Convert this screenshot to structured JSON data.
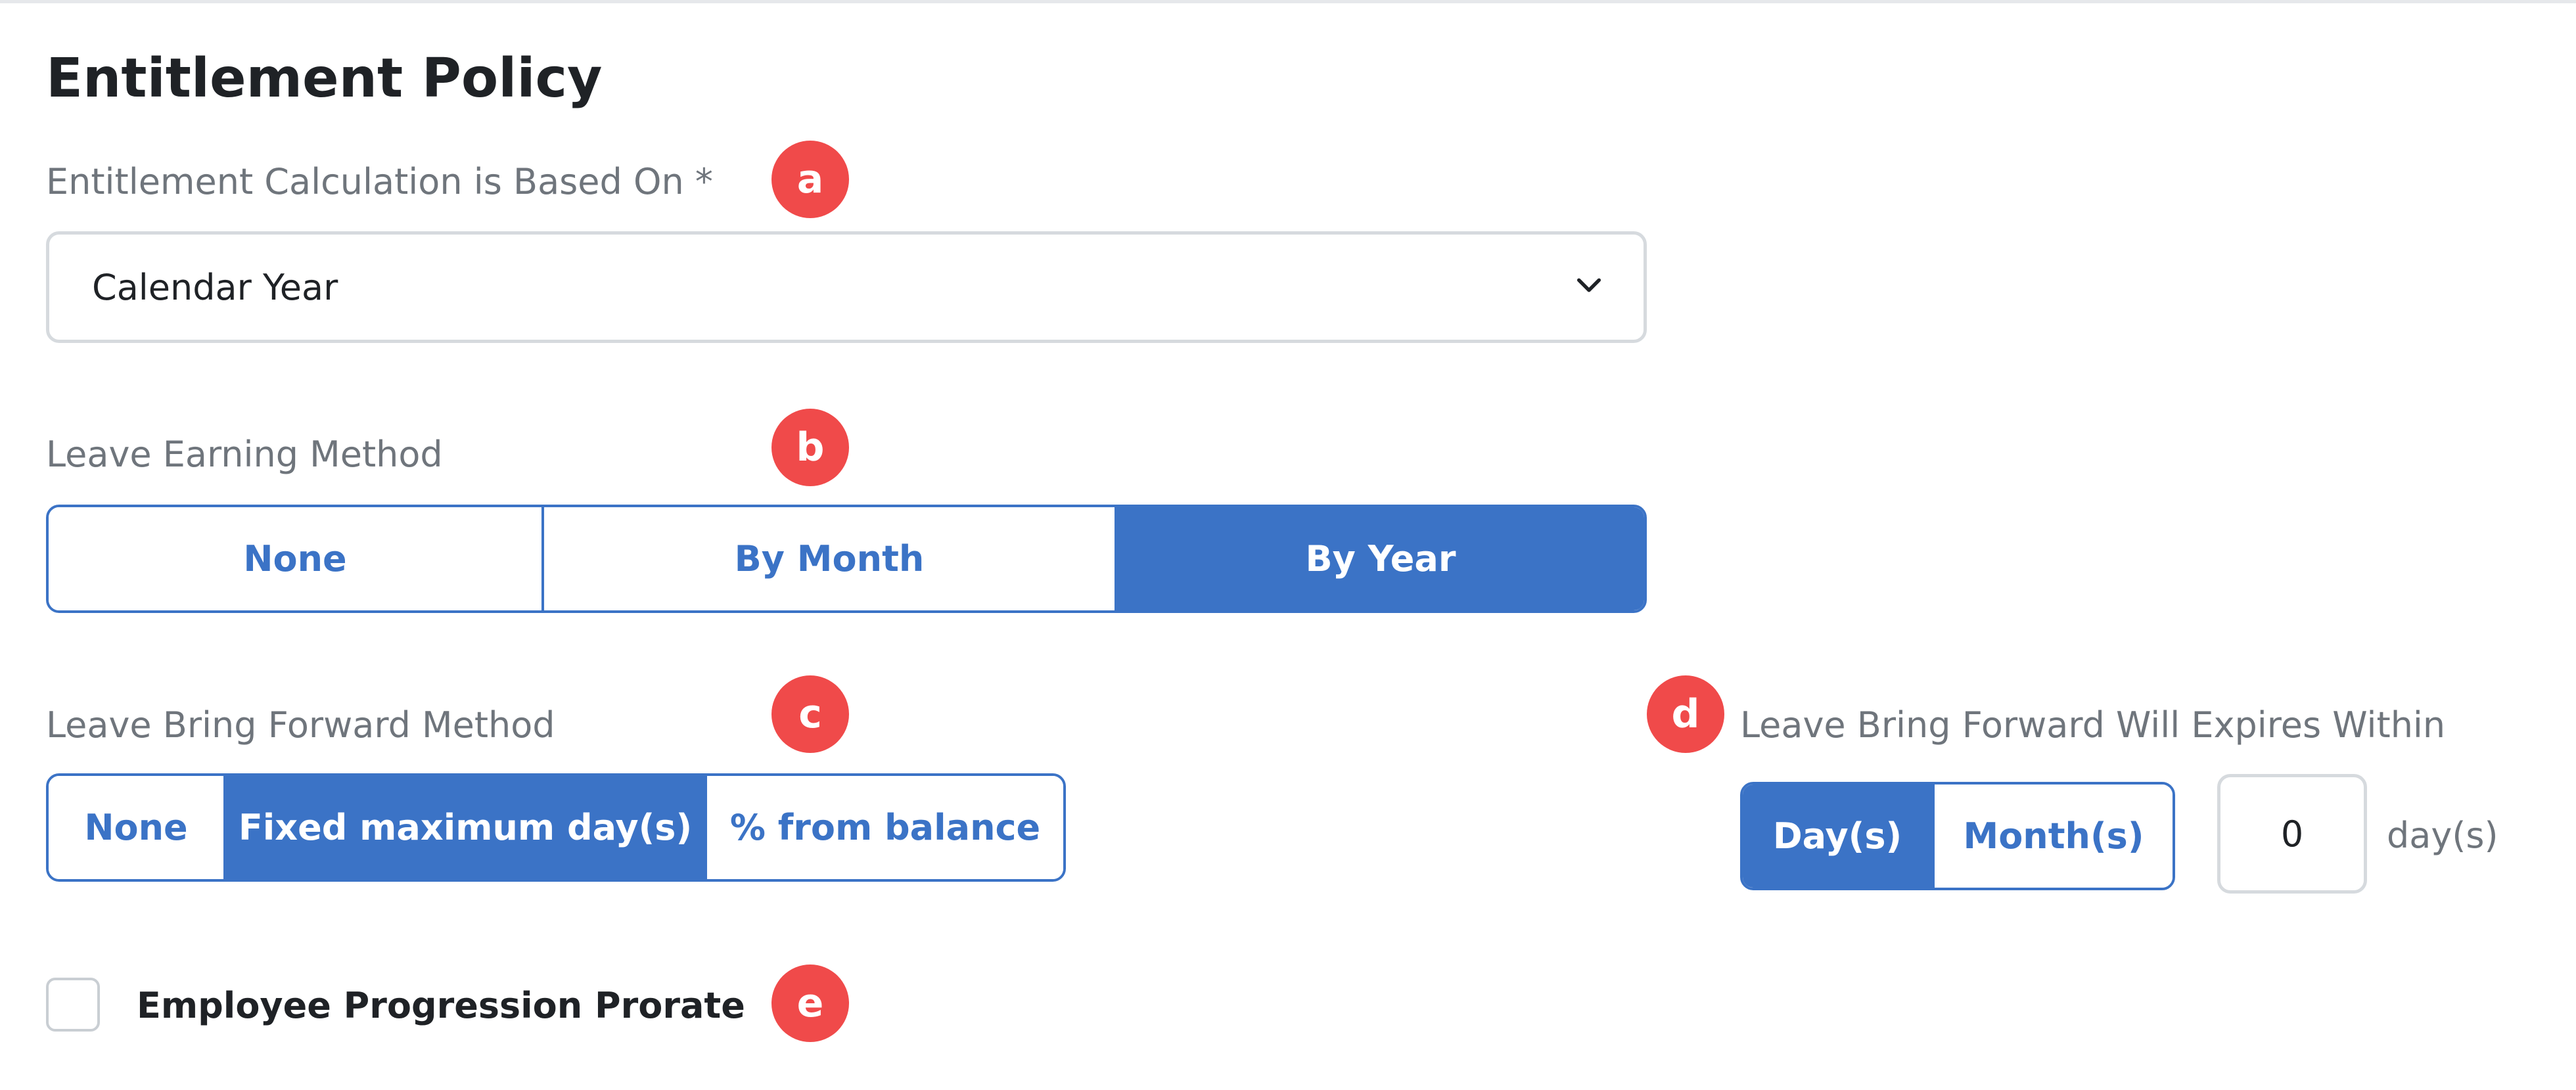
{
  "page_title": "Entitlement Policy",
  "markers": [
    "a",
    "b",
    "c",
    "d",
    "e"
  ],
  "entitlement_calculation": {
    "label": "Entitlement Calculation is Based On *",
    "selected": "Calendar Year",
    "icon": "chevron-down-icon"
  },
  "leave_earning_method": {
    "label": "Leave Earning Method",
    "options": [
      "None",
      "By Month",
      "By Year"
    ],
    "selected": "By Year"
  },
  "leave_bring_forward_method": {
    "label": "Leave Bring Forward Method",
    "options": [
      "None",
      "Fixed maximum day(s)",
      "% from balance"
    ],
    "selected": "Fixed maximum day(s)"
  },
  "bring_forward_expiry": {
    "label": "Leave Bring Forward Will Expires Within",
    "options": [
      "Day(s)",
      "Month(s)"
    ],
    "selected": "Day(s)",
    "value": "0",
    "unit": "day(s)"
  },
  "employee_progression_prorate": {
    "label": "Employee Progression Prorate",
    "checked": false
  },
  "colors": {
    "accent": "#3b73c6",
    "marker": "#f04a4a",
    "label": "#6f757c",
    "border": "#d6dade"
  }
}
